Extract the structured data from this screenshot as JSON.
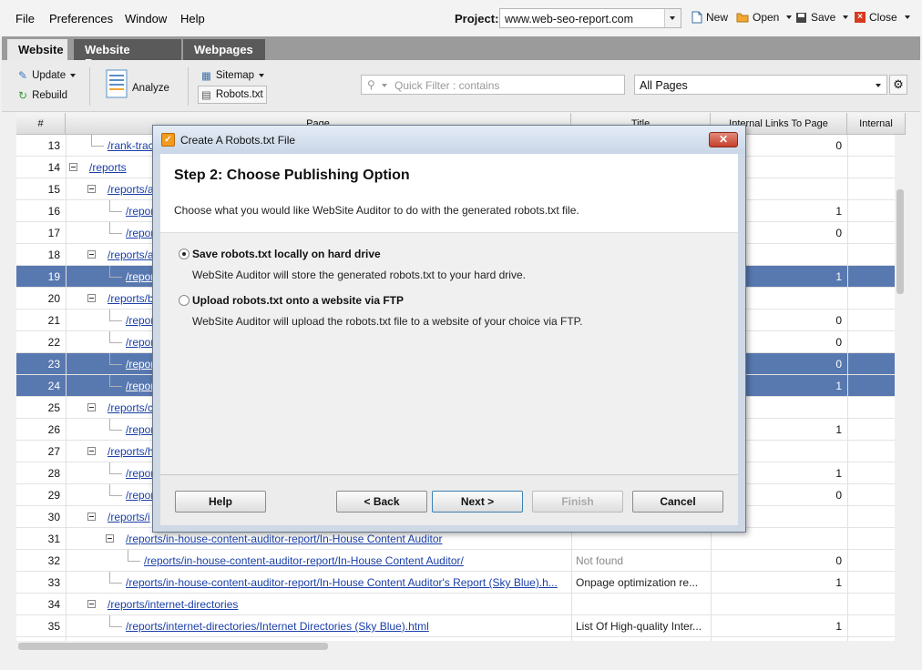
{
  "menu": [
    "File",
    "Preferences",
    "Window",
    "Help"
  ],
  "project": {
    "label": "Project:",
    "value": "www.web-seo-report.com"
  },
  "top_buttons": {
    "new": "New",
    "open": "Open",
    "save": "Save",
    "close": "Close"
  },
  "tabs": [
    "Website",
    "Website Report",
    "Webpages"
  ],
  "toolbar": {
    "update": "Update",
    "rebuild": "Rebuild",
    "analyze": "Analyze",
    "sitemap": "Sitemap",
    "robots": "Robots.txt",
    "filter_placeholder": "Quick Filter : contains",
    "pages_select": "All Pages"
  },
  "table": {
    "headers": [
      "#",
      "Page",
      "Title",
      "Internal Links To Page",
      "Internal"
    ],
    "rows": [
      {
        "n": "13",
        "url": "/rank-trac",
        "title": "",
        "links": "0",
        "sel": false
      },
      {
        "n": "14",
        "url": "/reports",
        "title": "",
        "links": "",
        "sel": false
      },
      {
        "n": "15",
        "url": "/reports/a",
        "title": "",
        "links": "",
        "sel": false
      },
      {
        "n": "16",
        "url": "/report",
        "title": "",
        "links": "1",
        "sel": false
      },
      {
        "n": "17",
        "url": "/report",
        "title": "",
        "links": "0",
        "sel": false
      },
      {
        "n": "18",
        "url": "/reports/a",
        "title": "",
        "links": "",
        "sel": false
      },
      {
        "n": "19",
        "url": "/report",
        "title": "",
        "links": "1",
        "sel": true
      },
      {
        "n": "20",
        "url": "/reports/b",
        "title": "",
        "links": "",
        "sel": false
      },
      {
        "n": "21",
        "url": "/report",
        "title": "",
        "links": "0",
        "sel": false
      },
      {
        "n": "22",
        "url": "/report",
        "title": "",
        "links": "0",
        "sel": false
      },
      {
        "n": "23",
        "url": "/report",
        "title": "",
        "links": "0",
        "sel": true
      },
      {
        "n": "24",
        "url": "/report",
        "title": "",
        "links": "1",
        "sel": true
      },
      {
        "n": "25",
        "url": "/reports/c",
        "title": "",
        "links": "",
        "sel": false
      },
      {
        "n": "26",
        "url": "/report",
        "title": "",
        "links": "1",
        "sel": false
      },
      {
        "n": "27",
        "url": "/reports/h",
        "title": "",
        "links": "",
        "sel": false
      },
      {
        "n": "28",
        "url": "/report",
        "title": "",
        "links": "1",
        "sel": false
      },
      {
        "n": "29",
        "url": "/report",
        "title": "",
        "links": "0",
        "sel": false
      },
      {
        "n": "30",
        "url": "/reports/i",
        "title": "",
        "links": "",
        "sel": false
      },
      {
        "n": "31",
        "url": "/reports/in-house-content-auditor-report/In-House Content Auditor",
        "title": "",
        "links": "",
        "sel": false
      },
      {
        "n": "32",
        "url": "/reports/in-house-content-auditor-report/In-House Content Auditor/",
        "title": "Not found",
        "links": "0",
        "sel": false
      },
      {
        "n": "33",
        "url": "/reports/in-house-content-auditor-report/In-House Content Auditor's Report (Sky Blue).h...",
        "title": "Onpage optimization re...",
        "links": "1",
        "sel": false
      },
      {
        "n": "34",
        "url": "/reports/internet-directories",
        "title": "",
        "links": "",
        "sel": false
      },
      {
        "n": "35",
        "url": "/reports/internet-directories/Internet Directories (Sky Blue).html",
        "title": "List Of High-quality Inter...",
        "links": "1",
        "sel": false
      }
    ]
  },
  "dialog": {
    "title": "Create A Robots.txt File",
    "step": "Step 2: Choose Publishing Option",
    "description": "Choose what you would like WebSite Auditor to do with the generated robots.txt file.",
    "options": [
      {
        "label": "Save robots.txt locally on hard drive",
        "desc": "WebSite Auditor will store the generated robots.txt to your hard drive.",
        "selected": true
      },
      {
        "label": "Upload robots.txt onto a website via FTP",
        "desc": "WebSite Auditor will upload the robots.txt file to a website of your choice via FTP.",
        "selected": false
      }
    ],
    "buttons": {
      "help": "Help",
      "back": "< Back",
      "next": "Next >",
      "finish": "Finish",
      "cancel": "Cancel"
    }
  }
}
